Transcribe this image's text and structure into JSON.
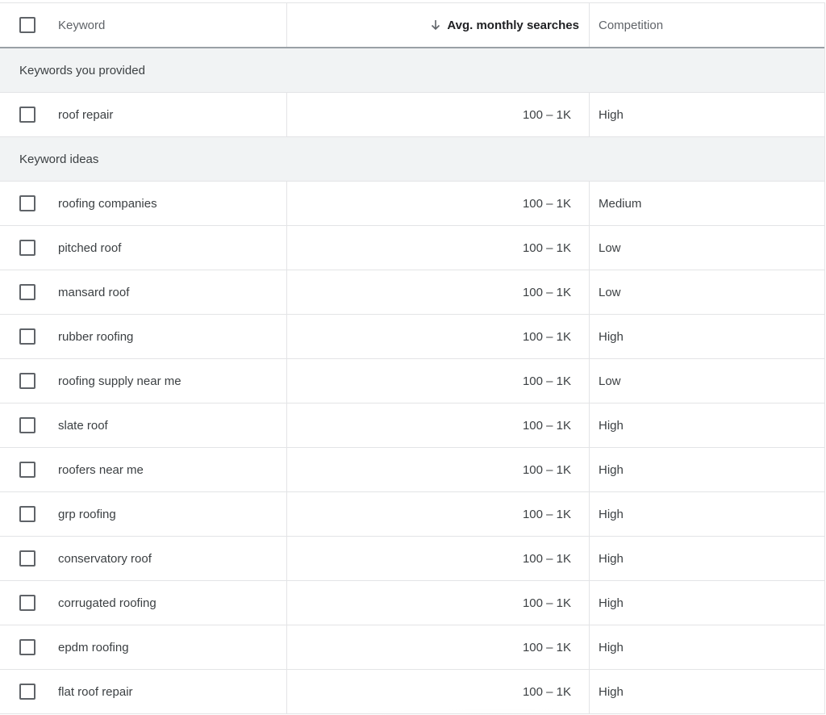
{
  "columns": {
    "keyword": "Keyword",
    "avg_monthly_searches": "Avg. monthly searches",
    "competition": "Competition",
    "sort_icon": "arrow-down-icon"
  },
  "sections": [
    {
      "title": "Keywords you provided",
      "rows": [
        {
          "keyword": "roof repair",
          "searches": "100 – 1K",
          "competition": "High"
        }
      ]
    },
    {
      "title": "Keyword ideas",
      "rows": [
        {
          "keyword": "roofing companies",
          "searches": "100 – 1K",
          "competition": "Medium"
        },
        {
          "keyword": "pitched roof",
          "searches": "100 – 1K",
          "competition": "Low"
        },
        {
          "keyword": "mansard roof",
          "searches": "100 – 1K",
          "competition": "Low"
        },
        {
          "keyword": "rubber roofing",
          "searches": "100 – 1K",
          "competition": "High"
        },
        {
          "keyword": "roofing supply near me",
          "searches": "100 – 1K",
          "competition": "Low"
        },
        {
          "keyword": "slate roof",
          "searches": "100 – 1K",
          "competition": "High"
        },
        {
          "keyword": "roofers near me",
          "searches": "100 – 1K",
          "competition": "High"
        },
        {
          "keyword": "grp roofing",
          "searches": "100 – 1K",
          "competition": "High"
        },
        {
          "keyword": "conservatory roof",
          "searches": "100 – 1K",
          "competition": "High"
        },
        {
          "keyword": "corrugated roofing",
          "searches": "100 – 1K",
          "competition": "High"
        },
        {
          "keyword": "epdm roofing",
          "searches": "100 – 1K",
          "competition": "High"
        },
        {
          "keyword": "flat roof repair",
          "searches": "100 – 1K",
          "competition": "High"
        }
      ]
    }
  ]
}
